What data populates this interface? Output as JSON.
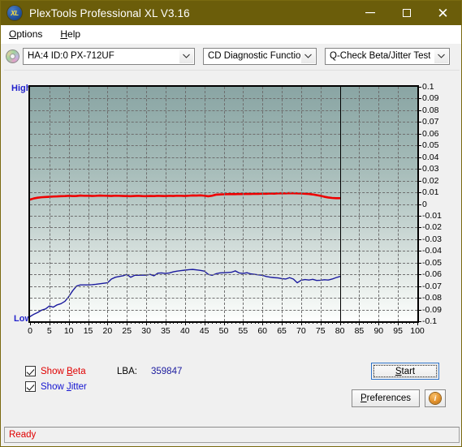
{
  "window": {
    "title": "PlexTools Professional XL V3.16",
    "icon": "xl-logo-icon",
    "minimize": "minimize-icon",
    "maximize": "maximize-icon",
    "close": "close-icon"
  },
  "menu": {
    "items": [
      {
        "label": "Options",
        "accel": "O"
      },
      {
        "label": "Help",
        "accel": "H"
      }
    ]
  },
  "toolbar": {
    "disc_icon": "disc-icon",
    "drive": {
      "value": "HA:4 ID:0  PX-712UF"
    },
    "function": {
      "value": "CD Diagnostic Functions"
    },
    "test": {
      "value": "Q-Check Beta/Jitter Test"
    }
  },
  "chart_data": {
    "type": "line",
    "title": "Q-Check Beta/Jitter Test",
    "xlabel": "",
    "ylabel": "",
    "grid": true,
    "legend_position": "bottom-left",
    "xlim": [
      0,
      100
    ],
    "ylim": [
      -0.1,
      0.1
    ],
    "left_axis_labels": {
      "top": "High",
      "bottom": "Low"
    },
    "xticks": [
      0,
      5,
      10,
      15,
      20,
      25,
      30,
      35,
      40,
      45,
      50,
      55,
      60,
      65,
      70,
      75,
      80,
      85,
      90,
      95,
      100
    ],
    "yticks": [
      0.1,
      0.09,
      0.08,
      0.07,
      0.06,
      0.05,
      0.04,
      0.03,
      0.02,
      0.01,
      0,
      -0.01,
      -0.02,
      -0.03,
      -0.04,
      -0.05,
      -0.06,
      -0.07,
      -0.08,
      -0.09,
      -0.1
    ],
    "data_end_x": 80,
    "series": [
      {
        "name": "Beta",
        "color": "#ee0000",
        "x": [
          0,
          1,
          2,
          3,
          4,
          5,
          6,
          7,
          8,
          9,
          10,
          11,
          12,
          13,
          14,
          15,
          16,
          17,
          18,
          19,
          20,
          21,
          22,
          23,
          24,
          25,
          26,
          27,
          28,
          29,
          30,
          31,
          32,
          33,
          34,
          35,
          36,
          37,
          38,
          39,
          40,
          41,
          42,
          43,
          44,
          45,
          46,
          47,
          48,
          49,
          50,
          51,
          52,
          53,
          54,
          55,
          56,
          57,
          58,
          59,
          60,
          61,
          62,
          63,
          64,
          65,
          66,
          67,
          68,
          69,
          70,
          71,
          72,
          73,
          74,
          75,
          76,
          77,
          78,
          79,
          80
        ],
        "values": [
          0.0038,
          0.0048,
          0.0054,
          0.0058,
          0.006,
          0.0062,
          0.0064,
          0.0065,
          0.0067,
          0.0068,
          0.007,
          0.0068,
          0.0069,
          0.0072,
          0.007,
          0.0071,
          0.0069,
          0.007,
          0.0072,
          0.0071,
          0.007,
          0.0069,
          0.0071,
          0.007,
          0.0069,
          0.0068,
          0.0067,
          0.0069,
          0.007,
          0.0068,
          0.0067,
          0.0069,
          0.0068,
          0.007,
          0.0069,
          0.0068,
          0.007,
          0.0069,
          0.0071,
          0.007,
          0.0069,
          0.0071,
          0.0073,
          0.0072,
          0.0074,
          0.0071,
          0.0066,
          0.0071,
          0.008,
          0.0082,
          0.0083,
          0.0084,
          0.0085,
          0.0084,
          0.0086,
          0.0085,
          0.0087,
          0.0086,
          0.0088,
          0.0087,
          0.0089,
          0.0088,
          0.009,
          0.0089,
          0.0091,
          0.0092,
          0.0091,
          0.0093,
          0.0092,
          0.0091,
          0.009,
          0.0088,
          0.0086,
          0.0082,
          0.0076,
          0.007,
          0.0062,
          0.0056,
          0.0052,
          0.005,
          0.005
        ]
      },
      {
        "name": "Jitter",
        "color": "#1a1a9e",
        "x": [
          0,
          1,
          2,
          3,
          4,
          5,
          6,
          7,
          8,
          9,
          10,
          11,
          12,
          13,
          14,
          15,
          16,
          17,
          18,
          19,
          20,
          21,
          22,
          23,
          24,
          25,
          26,
          27,
          28,
          29,
          30,
          31,
          32,
          33,
          34,
          35,
          36,
          37,
          38,
          39,
          40,
          41,
          42,
          43,
          44,
          45,
          46,
          47,
          48,
          49,
          50,
          51,
          52,
          53,
          54,
          55,
          56,
          57,
          58,
          59,
          60,
          61,
          62,
          63,
          64,
          65,
          66,
          67,
          68,
          69,
          70,
          71,
          72,
          73,
          74,
          75,
          76,
          77,
          78,
          79,
          80
        ],
        "values": [
          -0.096,
          -0.094,
          -0.0925,
          -0.0905,
          -0.0895,
          -0.087,
          -0.088,
          -0.086,
          -0.085,
          -0.083,
          -0.079,
          -0.074,
          -0.07,
          -0.069,
          -0.069,
          -0.069,
          -0.0688,
          -0.0685,
          -0.068,
          -0.0676,
          -0.0672,
          -0.064,
          -0.0625,
          -0.0618,
          -0.0612,
          -0.06,
          -0.0625,
          -0.0608,
          -0.0608,
          -0.0606,
          -0.0607,
          -0.06,
          -0.0612,
          -0.059,
          -0.0588,
          -0.0592,
          -0.0588,
          -0.0578,
          -0.0572,
          -0.0568,
          -0.0564,
          -0.056,
          -0.0558,
          -0.0562,
          -0.0566,
          -0.0572,
          -0.06,
          -0.0608,
          -0.0595,
          -0.0588,
          -0.0586,
          -0.0584,
          -0.0582,
          -0.057,
          -0.0588,
          -0.0592,
          -0.0586,
          -0.0596,
          -0.06,
          -0.0604,
          -0.0608,
          -0.0618,
          -0.0624,
          -0.0628,
          -0.063,
          -0.0636,
          -0.064,
          -0.0628,
          -0.064,
          -0.0672,
          -0.065,
          -0.0644,
          -0.0648,
          -0.0642,
          -0.0652,
          -0.065,
          -0.0646,
          -0.0648,
          -0.064,
          -0.0628,
          -0.0618
        ]
      }
    ]
  },
  "controls": {
    "show_beta": {
      "label": "Show Beta",
      "accel": "B",
      "checked": true,
      "color": "#e00000"
    },
    "show_jitter": {
      "label": "Show Jitter",
      "accel": "J",
      "checked": true,
      "color": "#1414d0"
    },
    "lba": {
      "label": "LBA:",
      "value": "359847"
    },
    "start_button": {
      "label": "Start",
      "accel": "S"
    },
    "preferences_button": {
      "label": "Preferences",
      "accel": "P"
    },
    "info_button": {
      "icon": "info-icon",
      "glyph": "i"
    }
  },
  "statusbar": {
    "text": "Ready"
  }
}
